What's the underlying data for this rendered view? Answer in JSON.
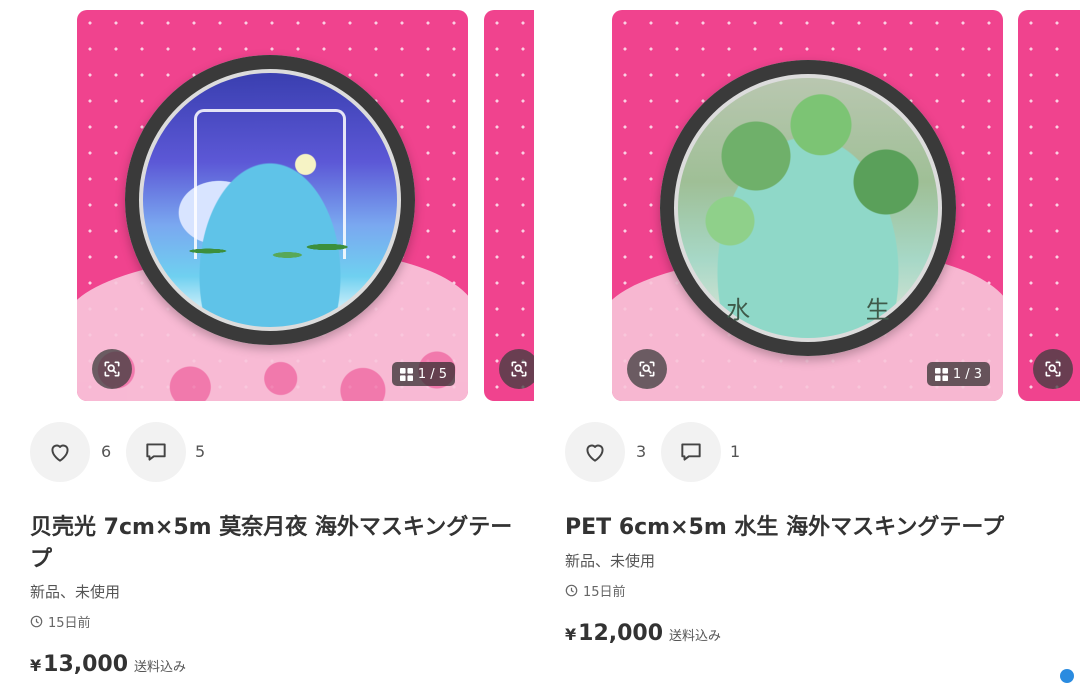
{
  "items": [
    {
      "image_counter": "1 / 5",
      "likes": "6",
      "comments": "5",
      "title_line1": "贝壳光 7cm×5m 莫奈月夜 海外マスキングテー",
      "title_line2": "プ",
      "condition": "新品、未使用",
      "posted": "15日前",
      "price_yen": "¥",
      "price_amount": "13,000",
      "shipping": "送料込み"
    },
    {
      "image_counter": "1 / 3",
      "likes": "3",
      "comments": "1",
      "title_line1": "PET 6cm×5m 水生 海外マスキングテープ",
      "condition": "新品、未使用",
      "posted": "15日前",
      "price_yen": "¥",
      "price_amount": "12,000",
      "shipping": "送料込み",
      "art_text": "水 生"
    }
  ],
  "icons": {
    "scan": "scan-search-icon",
    "gallery": "gallery-grid-icon",
    "like": "heart-icon",
    "comment": "comment-icon",
    "clock": "clock-icon"
  },
  "colors": {
    "image_bg": "#f0438e",
    "action_bg": "#f2f2f2",
    "scroll_indicator": "#2a8be0"
  }
}
